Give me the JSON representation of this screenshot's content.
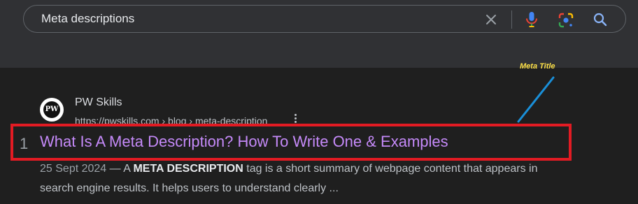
{
  "search": {
    "query": "Meta descriptions"
  },
  "icons": {
    "clear": "close-icon",
    "voice": "microphone-icon",
    "lens": "google-lens-icon",
    "search": "search-icon",
    "more": "more-vert-icon",
    "site_logo": "pw-skills-logo-icon"
  },
  "result": {
    "site_name": "PW Skills",
    "url": "https://pwskills.com › blog › meta-description",
    "rank": "1",
    "title": "What Is A Meta Description? How To Write One & Examples",
    "date": "25 Sept 2024",
    "dash": " — A ",
    "highlight": "META DESCRIPTION",
    "snippet_rest": " tag is a short summary of webpage content that appears in search engine results. It helps users to understand clearly ..."
  },
  "annotation": {
    "label": "Meta Title",
    "color": "#fde047",
    "line_color": "#1a8fd8",
    "box_color": "#e21b23"
  },
  "colors": {
    "title_link": "#c58af9",
    "background": "#1f1f1f",
    "header": "#303134"
  }
}
